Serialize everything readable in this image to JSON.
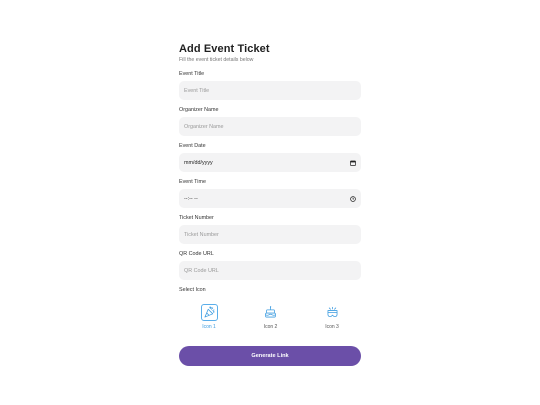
{
  "header": {
    "title": "Add Event Ticket",
    "subtitle": "Fill the event ticket details below"
  },
  "fields": [
    {
      "label": "Event Title",
      "placeholder": "Event Title"
    },
    {
      "label": "Organizer Name",
      "placeholder": "Organizer Name"
    },
    {
      "label": "Event Date",
      "value": "mm/dd/yyyy",
      "trailing_icon": "calendar-icon"
    },
    {
      "label": "Event Time",
      "value": "--:-- --",
      "trailing_icon": "clock-icon"
    },
    {
      "label": "Ticket Number",
      "placeholder": "Ticket Number"
    },
    {
      "label": "QR Code URL",
      "placeholder": "QR Code URL"
    }
  ],
  "icon_picker": {
    "label": "Select Icon",
    "options": [
      {
        "caption": "Icon 1",
        "icon": "party-popper-icon",
        "selected": true
      },
      {
        "caption": "Icon 2",
        "icon": "cake-icon",
        "selected": false
      },
      {
        "caption": "Icon 3",
        "icon": "vr-headset-icon",
        "selected": false
      }
    ]
  },
  "submit": {
    "label": "Generate Link"
  },
  "colors": {
    "accent": "#6b4fa8",
    "selected_icon": "#3d9ce0",
    "input_bg": "#f3f3f4"
  }
}
